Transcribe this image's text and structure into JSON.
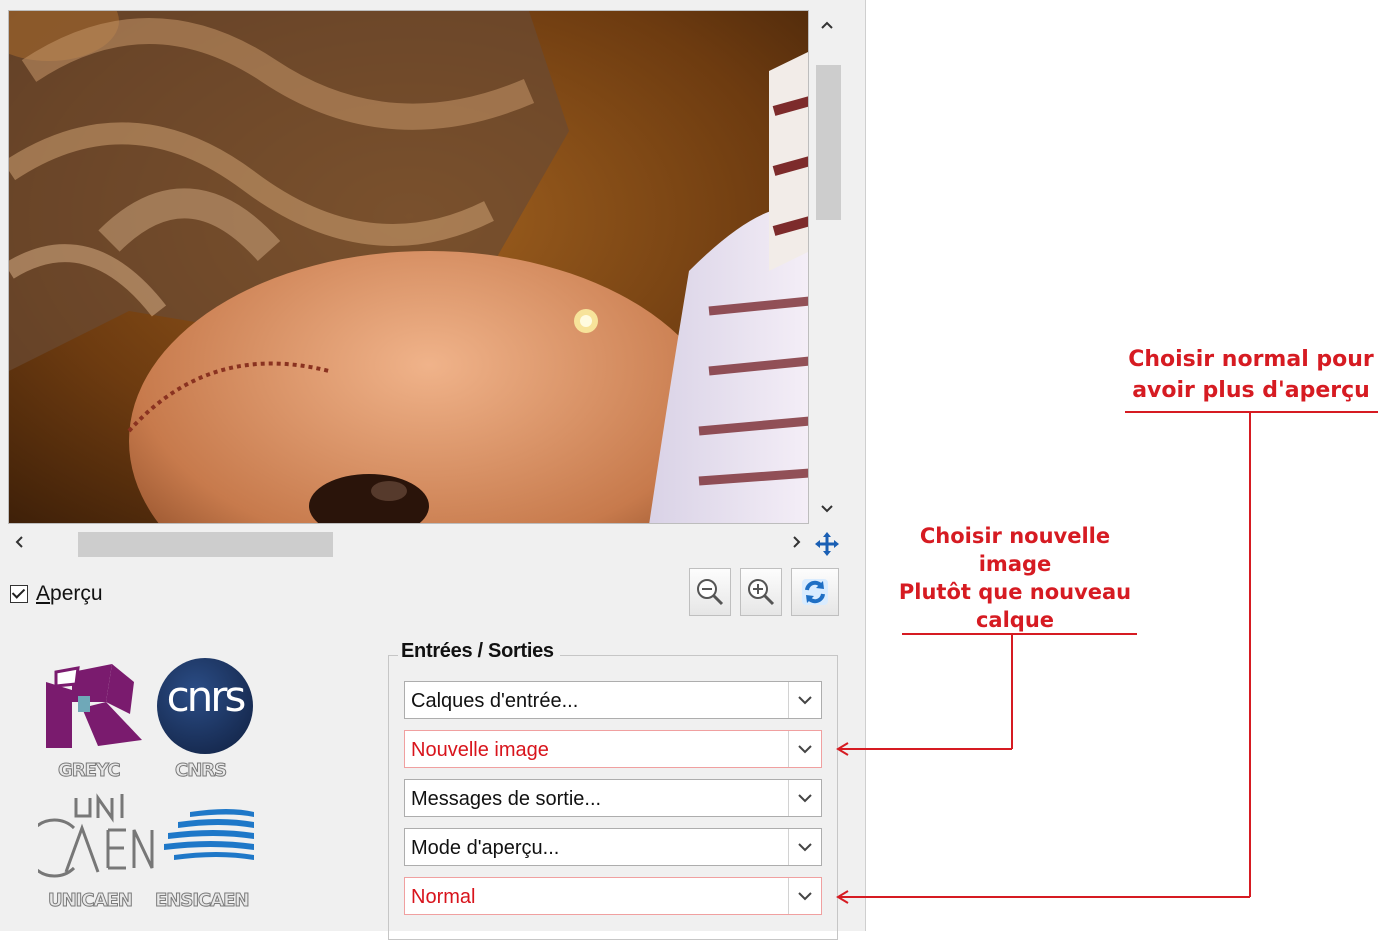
{
  "preview": {
    "checkbox_label_first": "A",
    "checkbox_label_rest": "perçu",
    "checked": true
  },
  "io_group": {
    "title": "Entrées / Sorties",
    "selects": [
      {
        "label": "Calques d'entrée...",
        "highlighted": false
      },
      {
        "label": "Nouvelle image",
        "highlighted": true
      },
      {
        "label": "Messages de sortie...",
        "highlighted": false
      },
      {
        "label": "Mode d'aperçu...",
        "highlighted": false
      },
      {
        "label": "Normal",
        "highlighted": true
      }
    ]
  },
  "logos": {
    "greyc": "GREYC",
    "cnrs_mark": "cnrs",
    "cnrs": "CNRS",
    "unicaen": "UNICAEN",
    "ensicaen": "ENSICAEN"
  },
  "annotations": {
    "new_image": [
      "Choisir nouvelle",
      "image",
      "Plutôt que nouveau",
      "calque"
    ],
    "normal": [
      "Choisir normal pour",
      "avoir plus d'aperçu"
    ]
  },
  "colors": {
    "annotation": "#d61b22",
    "panel_bg": "#f0f0f0"
  },
  "icons": [
    "scroll-up-icon",
    "scroll-down-icon",
    "scroll-left-icon",
    "scroll-right-icon",
    "move-icon",
    "zoom-out-icon",
    "zoom-in-icon",
    "refresh-icon",
    "chevron-down-icon"
  ]
}
